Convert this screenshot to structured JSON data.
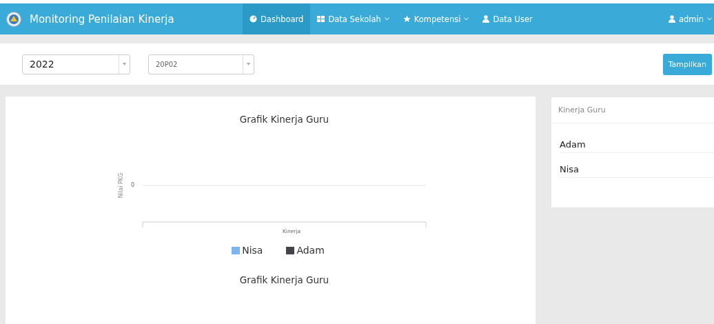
{
  "navbar": {
    "brand": "Monitoring Penilaian Kinerja",
    "items": [
      {
        "label": "Dashboard",
        "selected": true,
        "dropdown": false
      },
      {
        "label": "Data Sekolah",
        "selected": false,
        "dropdown": true
      },
      {
        "label": "Kompetensi",
        "selected": false,
        "dropdown": true
      },
      {
        "label": "Data User",
        "selected": false,
        "dropdown": false
      }
    ],
    "user": {
      "label": "admin",
      "dropdown": true
    }
  },
  "filters": {
    "year": "2022",
    "code": "20P02",
    "button": "Tampilkan"
  },
  "chart_panel": {
    "title": "Grafik Kinerja Guru",
    "y_axis_title": "Nilai PKG",
    "y_tick_labels": [
      "0"
    ],
    "x_axis_title": "Kinerja",
    "legend": [
      {
        "name": "Nisa",
        "color": "#7cb5ec"
      },
      {
        "name": "Adam",
        "color": "#434348"
      }
    ],
    "caption": "Grafik Kinerja Guru"
  },
  "side_panel": {
    "title": "Kinerja Guru",
    "items": [
      "Adam",
      "Nisa"
    ]
  }
}
